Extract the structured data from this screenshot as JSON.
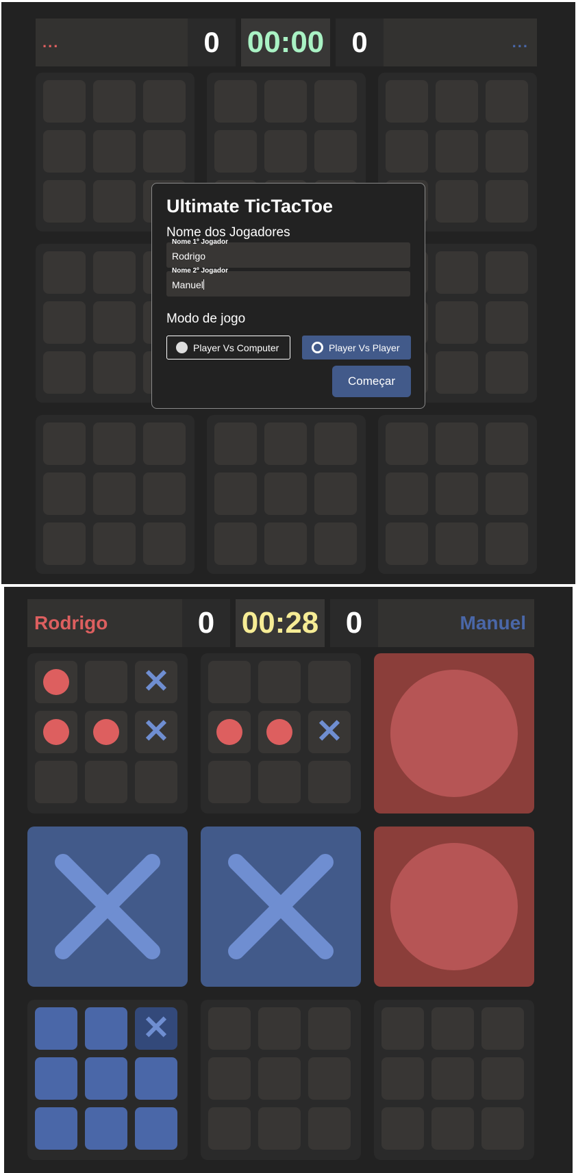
{
  "setup_screen": {
    "scoreboard": {
      "player1_name": "...",
      "player1_score": "0",
      "timer": "00:00",
      "player2_score": "0",
      "player2_name": "..."
    },
    "modal": {
      "title": "Ultimate TicTacToe",
      "players_heading": "Nome dos Jogadores",
      "player1_label": "Nome 1º Jogador",
      "player1_value": "Rodrigo",
      "player2_label": "Nome 2º Jogador",
      "player2_value": "Manuel",
      "mode_heading": "Modo de jogo",
      "mode_pvc": "Player Vs Computer",
      "mode_pvp": "Player Vs Player",
      "selected_mode": "Player Vs Player",
      "start_button": "Começar"
    }
  },
  "game_screen": {
    "scoreboard": {
      "player1_name": "Rodrigo",
      "player1_score": "0",
      "timer": "00:28",
      "player2_score": "0",
      "player2_name": "Manuel"
    },
    "boards": [
      {
        "winner": "",
        "cells": [
          "O",
          "",
          "X",
          "O",
          "O",
          "X",
          "",
          "",
          ""
        ]
      },
      {
        "winner": "",
        "cells": [
          "",
          "",
          "",
          "O",
          "O",
          "X",
          "",
          "",
          ""
        ]
      },
      {
        "winner": "O",
        "cells": []
      },
      {
        "winner": "X",
        "cells": []
      },
      {
        "winner": "X",
        "cells": []
      },
      {
        "winner": "O",
        "cells": []
      },
      {
        "winner": "",
        "active": true,
        "cells": [
          "",
          "",
          "X",
          "",
          "",
          "",
          "",
          "",
          ""
        ]
      },
      {
        "winner": "",
        "cells": [
          "",
          "",
          "",
          "",
          "",
          "",
          "",
          "",
          ""
        ]
      },
      {
        "winner": "",
        "cells": [
          "",
          "",
          "",
          "",
          "",
          "",
          "",
          "",
          ""
        ]
      }
    ]
  },
  "colors": {
    "background": "#222222",
    "player_o": "#dd5f5f",
    "player_x": "#4a67a8",
    "timer_idle": "#a9f2c4",
    "timer_running": "#f6ec95"
  },
  "icons": {
    "o_mark": "filled-circle",
    "x_mark": "cross"
  }
}
